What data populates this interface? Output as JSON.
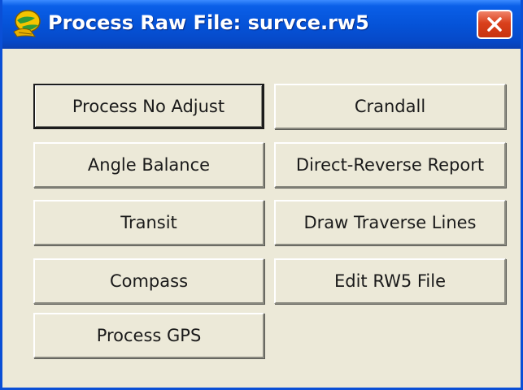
{
  "window": {
    "title": "Process Raw File: survce.rw5",
    "app_icon": "carlson-surveyor-icon",
    "close_icon": "close-icon"
  },
  "buttons": {
    "left": [
      {
        "label": "Process No Adjust",
        "default": true
      },
      {
        "label": "Angle Balance"
      },
      {
        "label": "Transit"
      },
      {
        "label": "Compass"
      },
      {
        "label": "Process GPS"
      }
    ],
    "right": [
      {
        "label": "Crandall"
      },
      {
        "label": "Direct-Reverse Report"
      },
      {
        "label": "Draw Traverse Lines"
      },
      {
        "label": "Edit RW5 File"
      }
    ]
  },
  "colors": {
    "titlebar": "#0553d8",
    "close_button": "#d9401c",
    "dialog_background": "#ece9d8"
  }
}
